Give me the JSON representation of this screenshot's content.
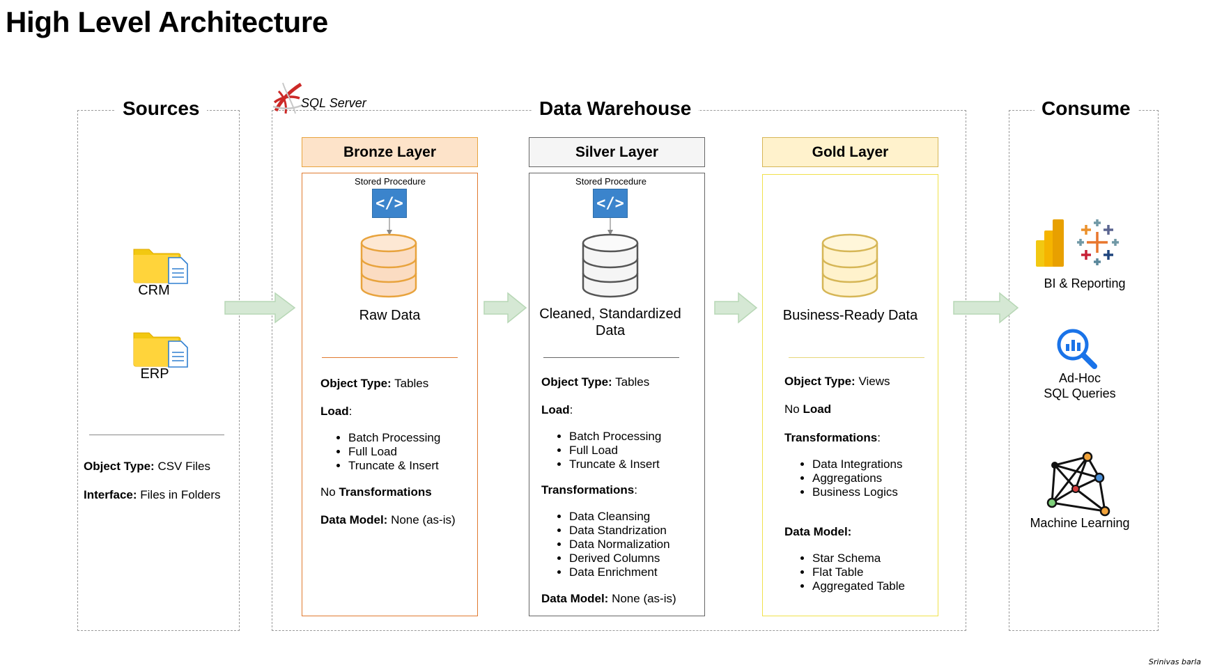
{
  "title": "High Level Architecture",
  "sources": {
    "title": "Sources",
    "items": [
      {
        "label": "CRM",
        "icon": "folder-file-icon"
      },
      {
        "label": "ERP",
        "icon": "folder-file-icon"
      }
    ],
    "object_type_label": "Object Type:",
    "object_type_value": "CSV Files",
    "interface_label": "Interface:",
    "interface_value": "Files in Folders"
  },
  "warehouse": {
    "title": "Data Warehouse",
    "platform": "SQL Server",
    "layers": {
      "bronze": {
        "header": "Bronze Layer",
        "procedure": "Stored Procedure",
        "caption": "Raw Data",
        "object_type_label": "Object Type:",
        "object_type_value": "Tables",
        "load_label": "Load",
        "load_items": [
          "Batch Processing",
          "Full Load",
          "Truncate & Insert"
        ],
        "transform_prefix": "No",
        "transform_label": "Transformations",
        "model_label": "Data Model:",
        "model_value": "None (as-is)",
        "colors": {
          "header_bg": "#fde3c9",
          "header_border": "#e8a33d",
          "body_border": "#e07a2f",
          "db_fill": "#fbdcc2",
          "db_stroke": "#e8a33d"
        }
      },
      "silver": {
        "header": "Silver Layer",
        "procedure": "Stored Procedure",
        "caption": "Cleaned, Standardized Data",
        "object_type_label": "Object Type:",
        "object_type_value": "Tables",
        "load_label": "Load",
        "load_items": [
          "Batch Processing",
          "Full Load",
          "Truncate & Insert"
        ],
        "transform_label": "Transformations",
        "transform_items": [
          "Data Cleansing",
          "Data Standrization",
          "Data Normalization",
          "Derived Columns",
          "Data Enrichment"
        ],
        "model_label": "Data Model:",
        "model_value": "None (as-is)",
        "colors": {
          "header_bg": "#f5f5f5",
          "header_border": "#666666",
          "body_border": "#666666",
          "db_fill": "#f5f5f5",
          "db_stroke": "#666666"
        }
      },
      "gold": {
        "header": "Gold Layer",
        "caption": "Business-Ready Data",
        "object_type_label": "Object Type:",
        "object_type_value": "Views",
        "load_prefix": "No",
        "load_label": "Load",
        "transform_label": "Transformations",
        "transform_items": [
          "Data Integrations",
          "Aggregations",
          "Business Logics"
        ],
        "model_label": "Data Model:",
        "model_items": [
          "Star Schema",
          "Flat Table",
          "Aggregated Table"
        ],
        "colors": {
          "header_bg": "#fff2cc",
          "header_border": "#d6b656",
          "body_border": "#f0e14a",
          "db_fill": "#fff2cc",
          "db_stroke": "#d6b656"
        }
      }
    }
  },
  "consume": {
    "title": "Consume",
    "items": [
      {
        "label": "BI & Reporting",
        "icon": "bi-tools-icon"
      },
      {
        "label": "Ad-Hoc SQL Queries",
        "line1": "Ad-Hoc",
        "line2": "SQL Queries",
        "icon": "query-magnifier-icon"
      },
      {
        "label": "Machine Learning",
        "icon": "network-graph-icon"
      }
    ]
  },
  "arrow_color": "#d5e8d4",
  "arrow_border": "#82b366",
  "signature": "Srinivas barla"
}
